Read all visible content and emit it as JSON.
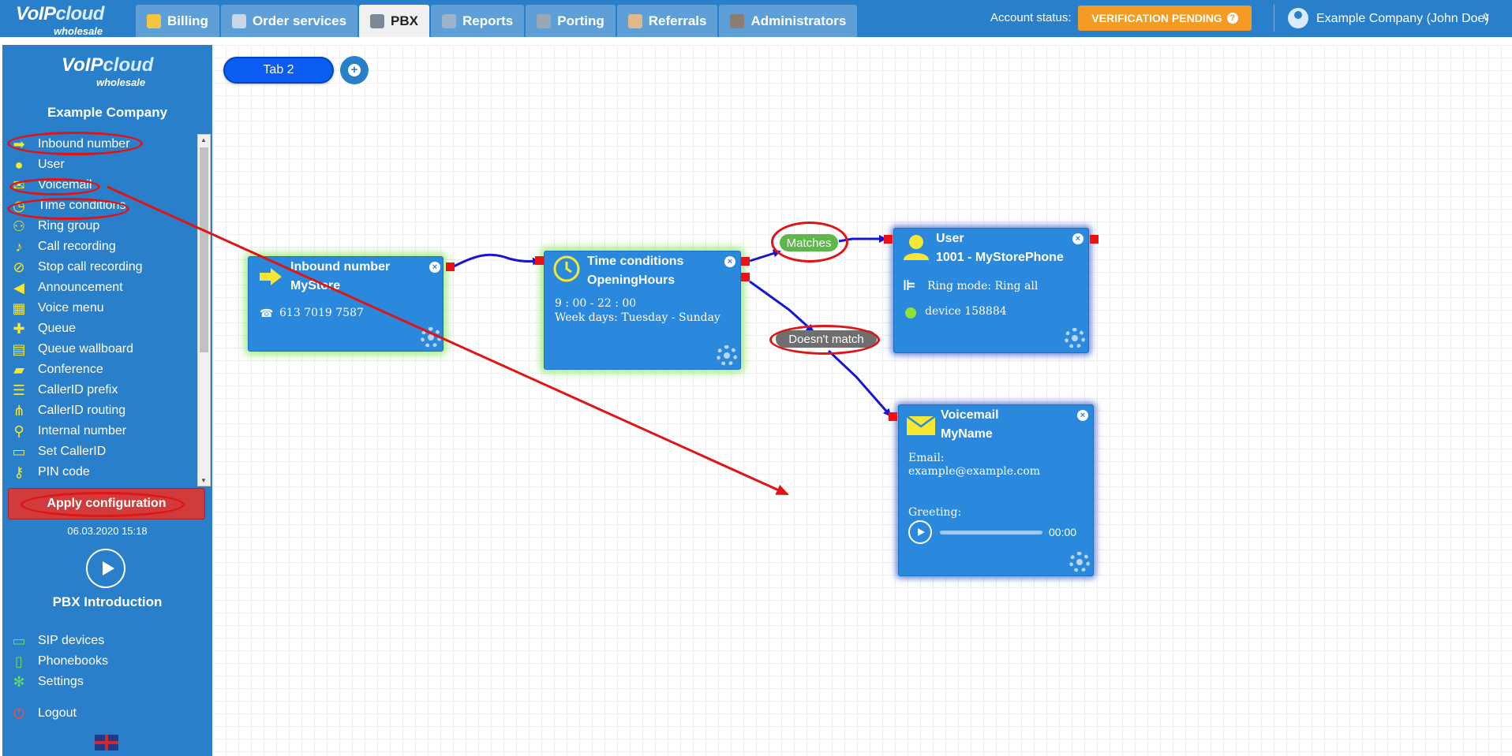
{
  "brand": {
    "name_part1": "VoIP",
    "name_part2": "cloud",
    "sub": "wholesale"
  },
  "tabs": [
    {
      "label": "Billing",
      "icon": "coins-icon",
      "active": false
    },
    {
      "label": "Order services",
      "icon": "cart-icon",
      "active": false
    },
    {
      "label": "PBX",
      "icon": "pbx-icon",
      "active": true
    },
    {
      "label": "Reports",
      "icon": "reports-icon",
      "active": false
    },
    {
      "label": "Porting",
      "icon": "porting-icon",
      "active": false
    },
    {
      "label": "Referrals",
      "icon": "referrals-icon",
      "active": false
    },
    {
      "label": "Administrators",
      "icon": "administrators-icon",
      "active": false
    }
  ],
  "account": {
    "status_label": "Account status:",
    "status_value": "VERIFICATION PENDING",
    "status_help": "?",
    "user_name": "Example Company (John Doe)",
    "chevron": "∨"
  },
  "sidebar": {
    "company": "Example Company",
    "items": [
      {
        "label": "Inbound number",
        "icon": "arrow-right-icon"
      },
      {
        "label": "User",
        "icon": "user-icon"
      },
      {
        "label": "Voicemail",
        "icon": "envelope-icon"
      },
      {
        "label": "Time conditions",
        "icon": "clock-icon"
      },
      {
        "label": "Ring group",
        "icon": "users-icon"
      },
      {
        "label": "Call recording",
        "icon": "microphone-icon"
      },
      {
        "label": "Stop call recording",
        "icon": "microphone-off-icon"
      },
      {
        "label": "Announcement",
        "icon": "megaphone-icon"
      },
      {
        "label": "Voice menu",
        "icon": "grid-icon"
      },
      {
        "label": "Queue",
        "icon": "user-plus-icon"
      },
      {
        "label": "Queue wallboard",
        "icon": "table-icon"
      },
      {
        "label": "Conference",
        "icon": "chat-icon"
      },
      {
        "label": "CallerID prefix",
        "icon": "list-icon"
      },
      {
        "label": "CallerID routing",
        "icon": "sitemap-icon"
      },
      {
        "label": "Internal number",
        "icon": "map-pin-icon"
      },
      {
        "label": "Set CallerID",
        "icon": "id-card-icon"
      },
      {
        "label": "PIN code",
        "icon": "key-icon"
      }
    ],
    "apply_button": "Apply configuration",
    "apply_date": "06.03.2020 15:18",
    "intro_label": "PBX Introduction",
    "bottom_items": [
      {
        "label": "SIP devices",
        "icon": "monitor-icon"
      },
      {
        "label": "Phonebooks",
        "icon": "book-icon"
      },
      {
        "label": "Settings",
        "icon": "gear-icon"
      }
    ],
    "logout": {
      "label": "Logout",
      "icon": "power-icon"
    }
  },
  "canvas": {
    "tab_label": "Tab 2",
    "add_tab": "+",
    "nodes": {
      "inbound": {
        "title": "Inbound number",
        "name": "MyStore",
        "phone": "613 7019 7587"
      },
      "time": {
        "title": "Time conditions",
        "name": "OpeningHours",
        "hours": "9 : 00 - 22 : 00",
        "days": "Week days: Tuesday - Sunday"
      },
      "user": {
        "title": "User",
        "name": "1001 - MyStorePhone",
        "ring_mode": "Ring mode: Ring all",
        "device": "device 158884"
      },
      "voicemail": {
        "title": "Voicemail",
        "name": "MyName",
        "email_label": "Email:",
        "email": "example@example.com",
        "greeting_label": "Greeting:",
        "time": "00:00"
      }
    },
    "badges": {
      "matches": "Matches",
      "no_match": "Doesn't match"
    }
  },
  "colors": {
    "topbar": "#2a7fca",
    "accent_orange": "#f59a23",
    "node_blue": "#2a88dd",
    "apply_red": "#d23b3b",
    "annotation_red": "#e01414",
    "connector_blue": "#1515d8"
  }
}
